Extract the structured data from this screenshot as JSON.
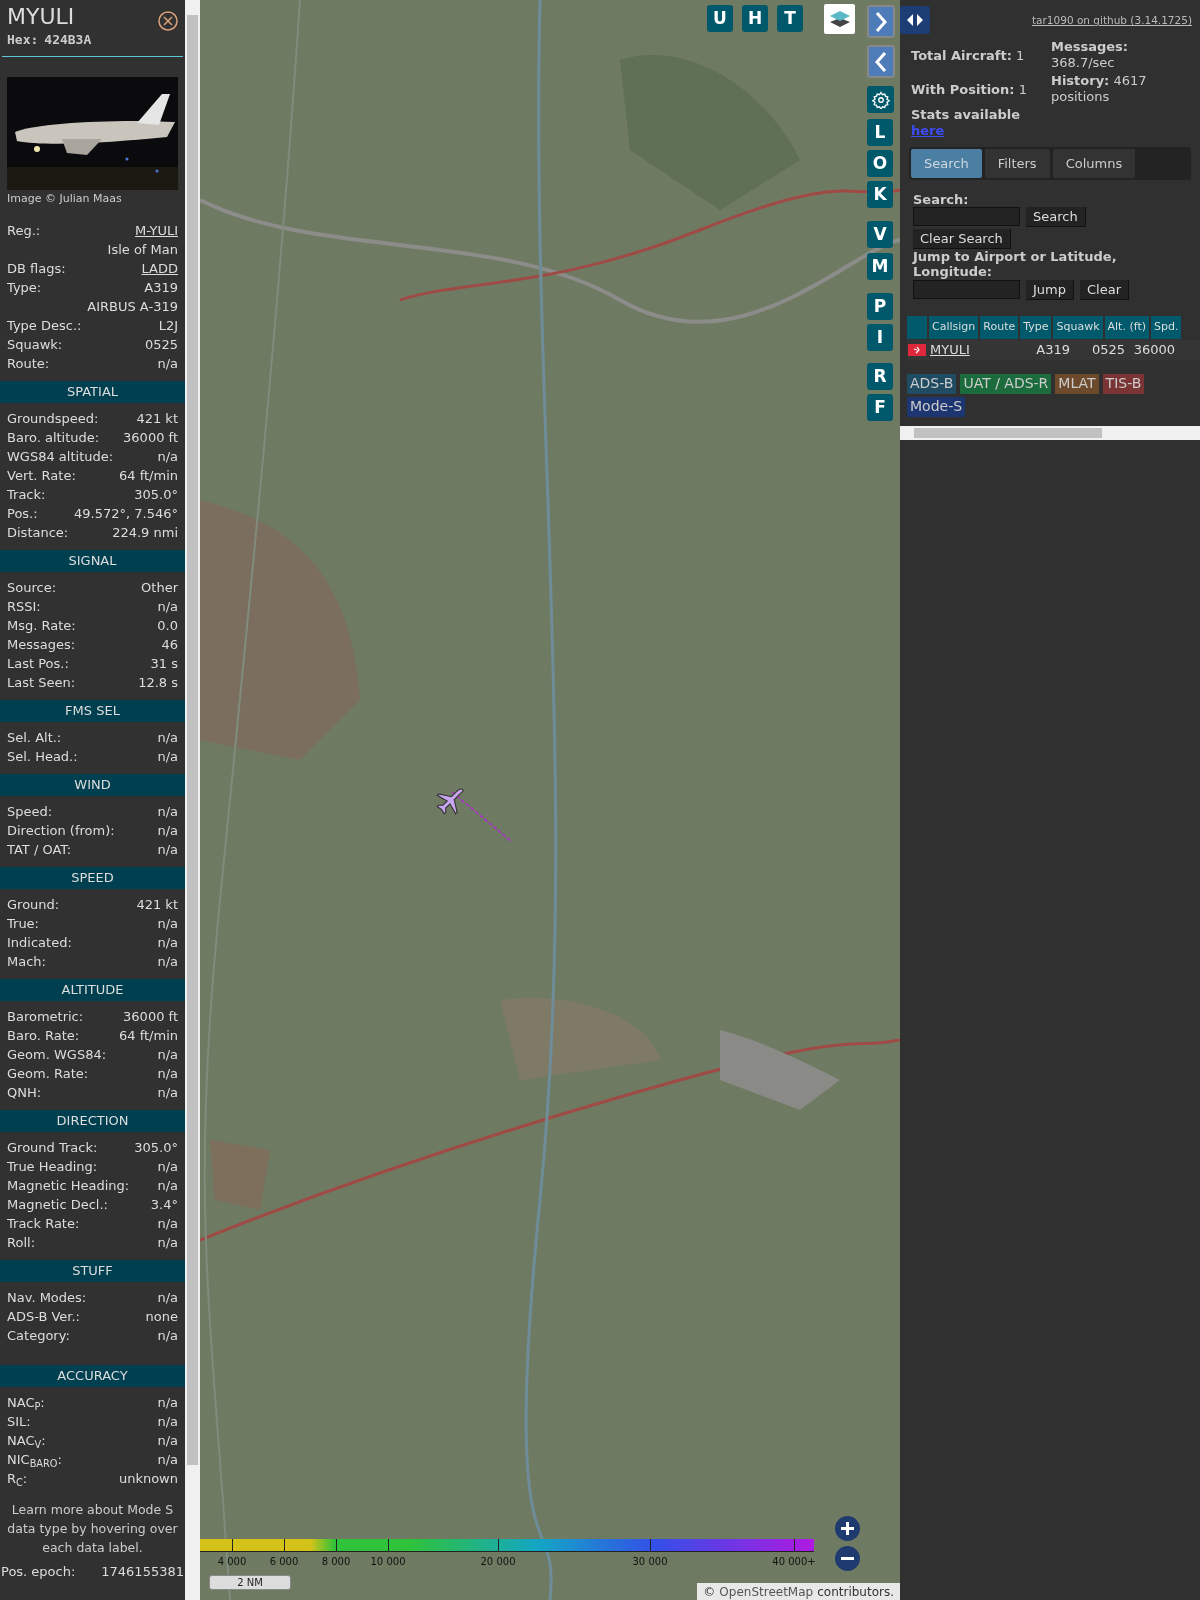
{
  "aircraft": {
    "callsign": "MYULI",
    "hex_label": "Hex:",
    "hex": "424B3A",
    "image_caption": "Image © Julian Maas"
  },
  "details": [
    {
      "label": "Reg.:",
      "value": "M-YULI",
      "link": true
    },
    {
      "value": "Isle of Man",
      "link": false
    },
    {
      "label": "DB flags:",
      "value": "LADD",
      "link": true
    },
    {
      "label": "Type:",
      "value": "A319",
      "link": false
    },
    {
      "value": "AIRBUS A-319",
      "link": false
    },
    {
      "label": "Type Desc.:",
      "value": "L2J",
      "link": false
    },
    {
      "label": "Squawk:",
      "value": "0525",
      "link": false
    },
    {
      "label": "Route:",
      "value": "n/a",
      "link": false
    }
  ],
  "sections": [
    {
      "title": "SPATIAL",
      "rows": [
        {
          "label": "Groundspeed:",
          "value": "421 kt"
        },
        {
          "label": "Baro. altitude:",
          "value": "36000 ft"
        },
        {
          "label": "WGS84 altitude:",
          "value": "n/a"
        },
        {
          "label": "Vert. Rate:",
          "value": "64 ft/min"
        },
        {
          "label": "Track:",
          "value": "305.0°"
        },
        {
          "label": "Pos.:",
          "value": "49.572°, 7.546°"
        },
        {
          "label": "Distance:",
          "value": "224.9 nmi"
        }
      ]
    },
    {
      "title": "SIGNAL",
      "rows": [
        {
          "label": "Source:",
          "value": "Other"
        },
        {
          "label": "RSSI:",
          "value": "n/a"
        },
        {
          "label": "Msg. Rate:",
          "value": "0.0"
        },
        {
          "label": "Messages:",
          "value": "46"
        },
        {
          "label": "Last Pos.:",
          "value": "31 s"
        },
        {
          "label": "Last Seen:",
          "value": "12.8 s"
        }
      ]
    },
    {
      "title": "FMS SEL",
      "rows": [
        {
          "label": "Sel. Alt.:",
          "value": "n/a"
        },
        {
          "label": "Sel. Head.:",
          "value": "n/a"
        }
      ]
    },
    {
      "title": "WIND",
      "rows": [
        {
          "label": "Speed:",
          "value": "n/a"
        },
        {
          "label": "Direction (from):",
          "value": "n/a"
        },
        {
          "label": "TAT / OAT:",
          "value": "n/a"
        }
      ]
    },
    {
      "title": "SPEED",
      "rows": [
        {
          "label": "Ground:",
          "value": "421 kt"
        },
        {
          "label": "True:",
          "value": "n/a"
        },
        {
          "label": "Indicated:",
          "value": "n/a"
        },
        {
          "label": "Mach:",
          "value": "n/a"
        }
      ]
    },
    {
      "title": "ALTITUDE",
      "rows": [
        {
          "label": "Barometric:",
          "value": "36000 ft"
        },
        {
          "label": "Baro. Rate:",
          "value": "64 ft/min"
        },
        {
          "label": "Geom. WGS84:",
          "value": "n/a"
        },
        {
          "label": "Geom. Rate:",
          "value": "n/a"
        },
        {
          "label": "QNH:",
          "value": "n/a"
        }
      ]
    },
    {
      "title": "DIRECTION",
      "rows": [
        {
          "label": "Ground Track:",
          "value": "305.0°"
        },
        {
          "label": "True Heading:",
          "value": "n/a"
        },
        {
          "label": "Magnetic Heading:",
          "value": "n/a"
        },
        {
          "label": "Magnetic Decl.:",
          "value": "3.4°"
        },
        {
          "label": "Track Rate:",
          "value": "n/a"
        },
        {
          "label": "Roll:",
          "value": "n/a"
        }
      ]
    },
    {
      "title": "STUFF",
      "rows": [
        {
          "label": "Nav. Modes:",
          "value": "n/a"
        },
        {
          "label": "ADS-B Ver.:",
          "value": "none"
        },
        {
          "label": "Category:",
          "value": "n/a"
        }
      ]
    },
    {
      "title": "ACCURACY",
      "rows": [
        {
          "label": "NAC$_{P}$:",
          "value": "n/a"
        },
        {
          "label": "SIL:",
          "value": "n/a"
        },
        {
          "label": "NAC$_{V}$:",
          "value": "n/a"
        },
        {
          "label": "NIC$_{BARO}$:",
          "value": "n/a"
        },
        {
          "label": "R$_{C}$:",
          "value": "unknown"
        }
      ]
    }
  ],
  "note": "Learn more about Mode S data type by hovering over each data label.",
  "epoch": {
    "label": "Pos. epoch:",
    "value": "1746155381"
  },
  "map": {
    "top_buttons": [
      "U",
      "H",
      "T"
    ],
    "side_buttons": [
      "L",
      "O",
      "K",
      "V",
      "M",
      "P",
      "I",
      "R",
      "F"
    ],
    "legend": [
      "4 000",
      "6 000",
      "8 000",
      "10 000",
      "20 000",
      "30 000",
      "40 000+"
    ],
    "scale": "2 NM",
    "attribution_prefix": "©",
    "attribution_link": "OpenStreetMap",
    "attribution_suffix": "contributors."
  },
  "header_link": "tar1090 on github (3.14.1725)",
  "stats_left": [
    {
      "label": "Total Aircraft:",
      "value": "1"
    },
    {
      "label": "With Position:",
      "value": "1"
    }
  ],
  "stats_right": [
    {
      "label": "Messages:",
      "value": "368.7/sec"
    },
    {
      "label": "History:",
      "value": "4617 positions"
    }
  ],
  "stats_link_label": "Stats available",
  "stats_link": "here",
  "tabs": [
    {
      "label": "Search",
      "selected": true
    },
    {
      "label": "Filters",
      "selected": false
    },
    {
      "label": "Columns",
      "selected": false
    }
  ],
  "search": {
    "label": "Search:",
    "button": "Search",
    "clear_button": "Clear Search",
    "jump_label": "Jump to Airport or Latitude, Longitude:",
    "jump_button": "Jump",
    "jump_clear": "Clear"
  },
  "table": {
    "columns": [
      "Callsign",
      "Route",
      "Type",
      "Squawk",
      "Alt. (ft)",
      "Spd."
    ],
    "rows": [
      {
        "cells": [
          "MYULI",
          "",
          "A319",
          "0525",
          "36000"
        ]
      }
    ]
  },
  "sources": [
    {
      "label": "ADS-B",
      "color": "#1f4b63"
    },
    {
      "label": "UAT / ADS-R",
      "color": "#1c6b3c"
    },
    {
      "label": "MLAT",
      "color": "#6e4a2c"
    },
    {
      "label": "TIS-B",
      "color": "#7a3434"
    },
    {
      "label": "Mode-S",
      "color": "#1d3570"
    }
  ]
}
